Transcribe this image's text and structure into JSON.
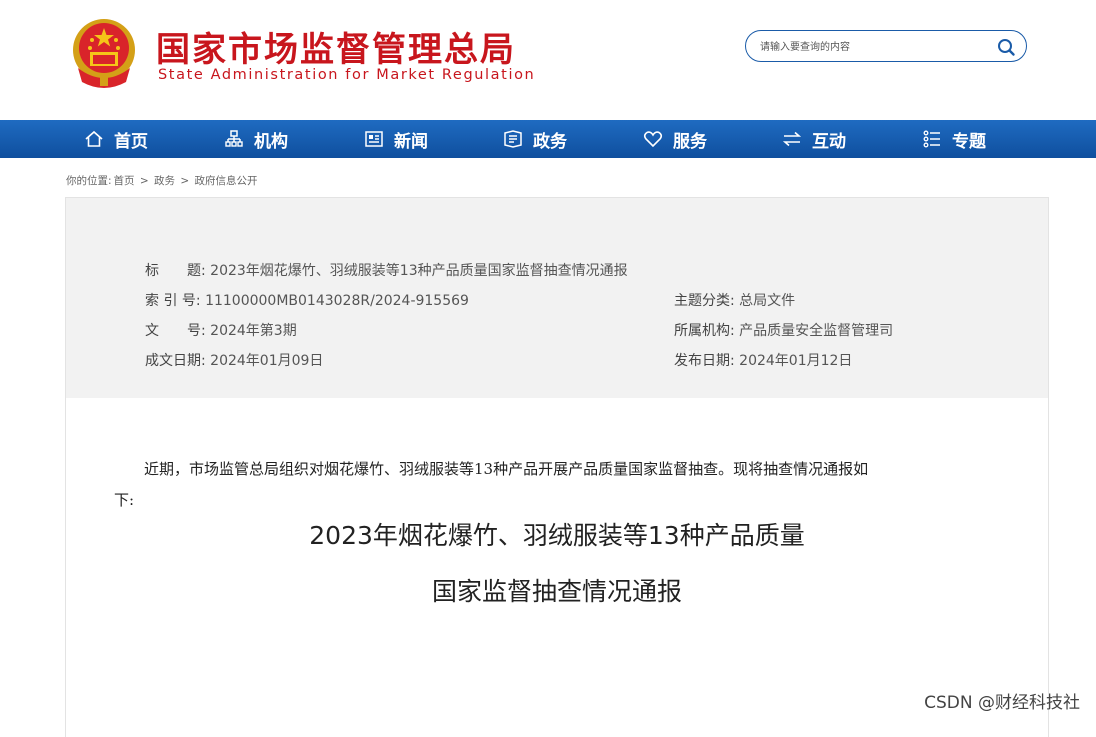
{
  "header": {
    "title_cn": "国家市场监督管理总局",
    "title_en": "State Administration for Market Regulation",
    "search_placeholder": "请输入要查询的内容"
  },
  "nav": {
    "items": [
      {
        "label": "首页",
        "icon": "home-icon"
      },
      {
        "label": "机构",
        "icon": "org-icon"
      },
      {
        "label": "新闻",
        "icon": "news-icon"
      },
      {
        "label": "政务",
        "icon": "affairs-icon"
      },
      {
        "label": "服务",
        "icon": "heart-icon"
      },
      {
        "label": "互动",
        "icon": "swap-icon"
      },
      {
        "label": "专题",
        "icon": "list-icon"
      }
    ]
  },
  "breadcrumb": {
    "prefix": "你的位置:",
    "items": [
      "首页",
      "政务",
      "政府信息公开"
    ],
    "separator": ">"
  },
  "meta": {
    "title_label": "标　　题:",
    "title_value": "2023年烟花爆竹、羽绒服装等13种产品质量国家监督抽查情况通报",
    "index_label": "索 引 号:",
    "index_value": "11100000MB0143028R/2024-915569",
    "doc_label": "文　　号:",
    "doc_value": "2024年第3期",
    "written_label": "成文日期:",
    "written_value": "2024年01月09日",
    "category_label": "主题分类:",
    "category_value": "总局文件",
    "org_label": "所属机构:",
    "org_value": "产品质量安全监督管理司",
    "publish_label": "发布日期:",
    "publish_value": "2024年01月12日"
  },
  "article": {
    "title_line1": "2023年烟花爆竹、羽绒服装等13种产品质量",
    "title_line2": "国家监督抽查情况通报",
    "paragraph1": "近期，市场监管总局组织对烟花爆竹、羽绒服装等13种产品开展产品质量国家监督抽查。现将抽查情况通报如下:"
  },
  "watermark": "CSDN @财经科技社",
  "colors": {
    "brand_red": "#c8161d",
    "nav_blue": "#1558ab",
    "meta_bg": "#f2f2f2"
  }
}
